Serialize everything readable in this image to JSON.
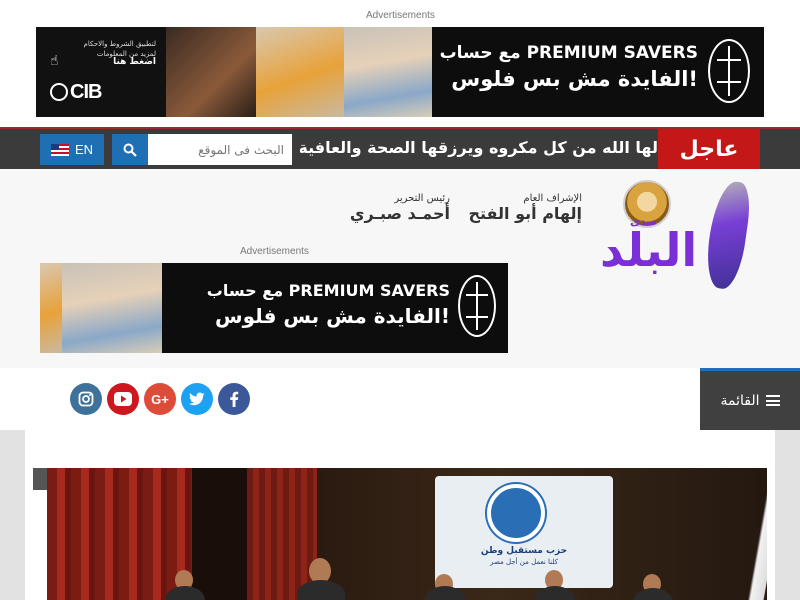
{
  "ads": {
    "top_label": "Advertisements",
    "mid_label": "Advertisements"
  },
  "top_banner": {
    "side_text": "لتطبيق الشروط والاحكام لمزيد من المعلومات",
    "side_press": "اضغط هنا",
    "side_logo": "CIB",
    "promo_line1": "مع حساب PREMIUM SAVERS",
    "promo_line2": "الفايدة مش بس فلوس!"
  },
  "mid_banner": {
    "promo_line1": "مع حساب PREMIUM SAVERS",
    "promo_line2": "الفايدة مش بس فلوس!"
  },
  "topbar": {
    "lang_label": "EN",
    "search_placeholder": "البحث فى الموقع",
    "ticker_text": "لها الله من كل مكروه ويرزقها الصحة والعافية",
    "breaking_label": "عاجل"
  },
  "header": {
    "logo_small": "صدى",
    "logo_name": "البلد",
    "supervisor_role": "الإشراف العام",
    "supervisor_name": "إلهام أبو الفتح",
    "editor_role": "رئيس التحرير",
    "editor_name": "أحمـد صبـري"
  },
  "nav": {
    "menu_label": "القائمة"
  },
  "social": [
    {
      "name": "instagram",
      "glyph": "◎",
      "color": "#3f729b"
    },
    {
      "name": "youtube",
      "glyph": "▶",
      "color": "#cc181e"
    },
    {
      "name": "google-plus",
      "glyph": "G+",
      "color": "#dd4b39"
    },
    {
      "name": "twitter",
      "glyph": "t",
      "color": "#1da1f2"
    },
    {
      "name": "facebook",
      "glyph": "f",
      "color": "#3b5998"
    }
  ],
  "hero": {
    "screen_title": "حزب مستقبل وطن",
    "screen_subtitle": "كلنا نعمل من أجل مصر"
  }
}
